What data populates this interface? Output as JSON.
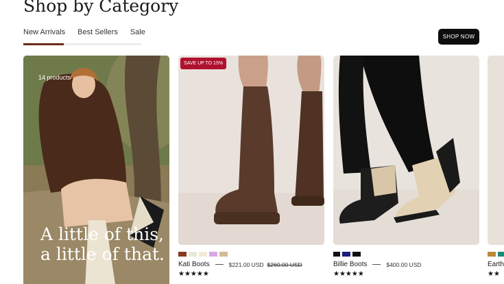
{
  "header": {
    "title": "Shop by Category",
    "shop_now_label": "SHOP NOW"
  },
  "tabs": [
    {
      "label": "New Arrivals",
      "active": true
    },
    {
      "label": "Best Sellers",
      "active": false
    },
    {
      "label": "Sale",
      "active": false
    }
  ],
  "promo": {
    "count": "14 products",
    "headline": "A little of this, a little of that."
  },
  "products": [
    {
      "name": "Kati Boots",
      "price": "$221.00 USD",
      "old_price": "$260.00 USD",
      "badge": "SAVE UP TO 15%",
      "rating": "★★★★★",
      "swatches": [
        "#8a3a22",
        "#e8ead8",
        "#f3ead6",
        "#d9a6e3",
        "#d6b995"
      ]
    },
    {
      "name": "Billie Boots",
      "price": "$400.00 USD",
      "rating": "★★★★★",
      "swatches": [
        "#111111",
        "#1d1f7a",
        "#111111"
      ]
    },
    {
      "name": "Earth",
      "rating": "★★",
      "swatches": [
        "#b98a3a",
        "#1f8a7a"
      ]
    }
  ],
  "colors": {
    "accent_bar": "#6b2a17",
    "badge": "#b0112e",
    "button": "#0d0d0d"
  }
}
